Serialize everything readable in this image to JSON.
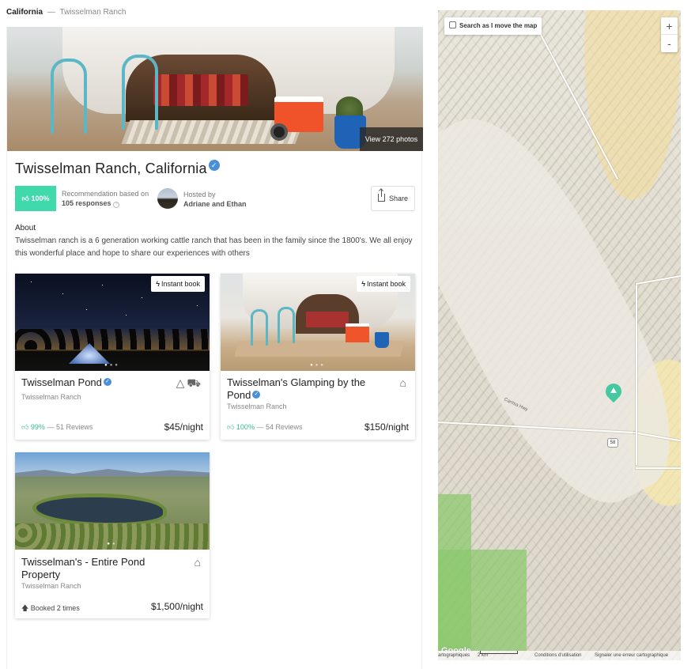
{
  "breadcrumb": {
    "current": "California",
    "separator": "—",
    "child": "Twisselman Ranch"
  },
  "hero": {
    "view_photos_label": "View 272 photos"
  },
  "listing": {
    "title": "Twisselman Ranch, California",
    "recommendation_pct": "100%",
    "recommendation_text": "Recommendation based on",
    "recommendation_count": "105 responses",
    "hosted_by_label": "Hosted by",
    "hosts": "Adriane and Ethan",
    "share_label": "Share",
    "about_heading": "About",
    "about_text": "Twisselman ranch is a 6 generation working cattle ranch that has been in the family since the 1800's. We all enjoy this wonderful place and hope to share our experiences with others"
  },
  "cards": [
    {
      "name": "Twisselman Pond",
      "subtitle": "Twisselman Ranch",
      "instant_book": "Instant book",
      "rating_pct": "99%",
      "reviews": "— 51 Reviews",
      "price": "$45/night",
      "icons": [
        "tent-icon",
        "rv-icon"
      ]
    },
    {
      "name": "Twisselman's Glamping by the Pond",
      "subtitle": "Twisselman Ranch",
      "instant_book": "Instant book",
      "rating_pct": "100%",
      "reviews": "— 54 Reviews",
      "price": "$150/night",
      "icons": [
        "cabin-icon"
      ]
    },
    {
      "name": "Twisselman's - Entire Pond Property",
      "subtitle": "Twisselman Ranch",
      "booked": "Booked 2 times",
      "price": "$1,500/night",
      "icons": [
        "cabin-icon"
      ]
    }
  ],
  "map": {
    "search_as_move_label": "Search as I move the map",
    "search_as_move_checked": false,
    "zoom_in": "+",
    "zoom_out": "-",
    "google_logo": "Google",
    "road_label": "Carrisa Hwy",
    "route_shield": "58",
    "attribution_data": "artographiques",
    "scale_label": "2 km",
    "terms": "Conditions d'utilisation",
    "report": "Signaler une erreur cartographique",
    "colors": {
      "pin": "#45c9a2",
      "green_area": "#8cc86e"
    }
  },
  "colors": {
    "accent_green": "#40d9ac",
    "verified_blue": "#4a90d9",
    "rating_green": "#2fbf8f"
  }
}
